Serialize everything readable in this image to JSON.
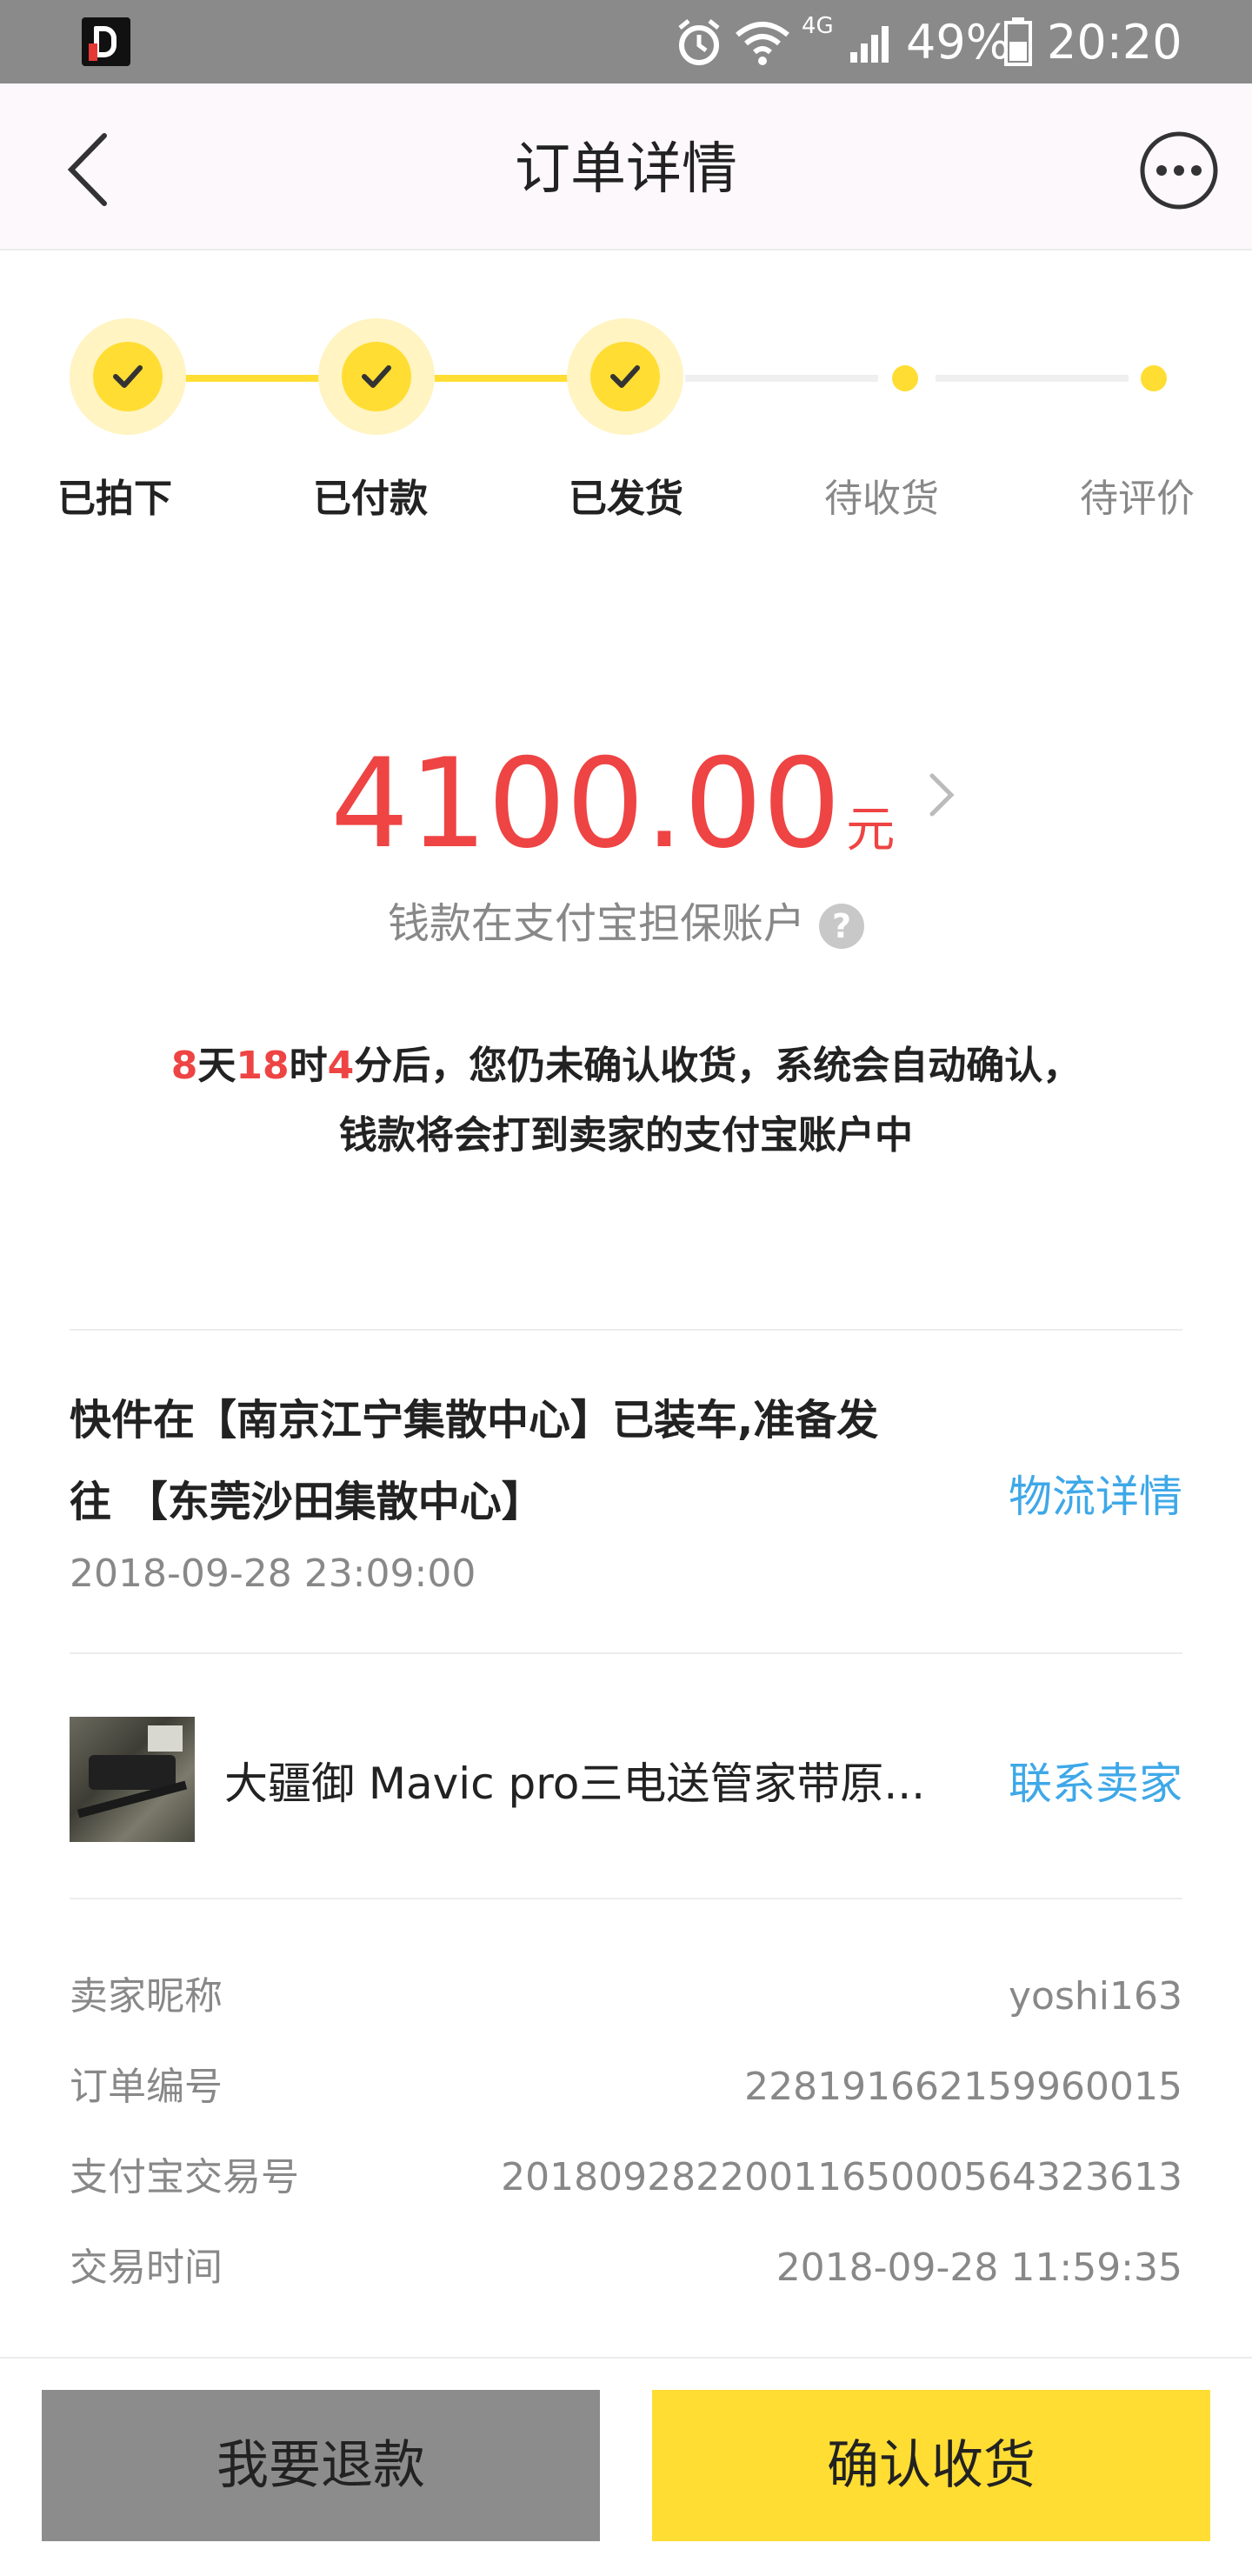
{
  "status_bar": {
    "battery": "49%",
    "time": "20:20",
    "network": "4G"
  },
  "nav": {
    "title": "订单详情"
  },
  "steps": [
    {
      "label": "已拍下",
      "done": true
    },
    {
      "label": "已付款",
      "done": true
    },
    {
      "label": "已发货",
      "done": true
    },
    {
      "label": "待收货",
      "done": false
    },
    {
      "label": "待评价",
      "done": false
    }
  ],
  "amount": {
    "value": "4100.00",
    "unit": "元",
    "escrow_text": "钱款在支付宝担保账户",
    "help_glyph": "?"
  },
  "notice": {
    "days": "8",
    "days_unit": "天",
    "hours": "18",
    "hours_unit": "时",
    "minutes": "4",
    "line1_rest": "分后，您仍未确认收货，系统会自动确认，",
    "line2": "钱款将会打到卖家的支付宝账户中"
  },
  "logistics": {
    "line1": "快件在【南京江宁集散中心】已装车,准备发",
    "line2": "往 【东莞沙田集散中心】",
    "time": "2018-09-28 23:09:00",
    "link": "物流详情"
  },
  "product": {
    "title": "大疆御 Mavic pro三电送管家带原...",
    "link": "联系卖家"
  },
  "info": [
    {
      "label": "卖家昵称",
      "value": "yoshi163"
    },
    {
      "label": "订单编号",
      "value": "228191662159960015"
    },
    {
      "label": "支付宝交易号",
      "value": "2018092822001165000564323613"
    },
    {
      "label": "交易时间",
      "value": "2018-09-28 11:59:35"
    }
  ],
  "actions": {
    "refund": "我要退款",
    "confirm": "确认收货"
  },
  "colors": {
    "accent_yellow": "#ffdd33",
    "price_red": "#ee4444",
    "link_blue": "#3ea8e8",
    "status_bar": "#8a8a8a"
  }
}
